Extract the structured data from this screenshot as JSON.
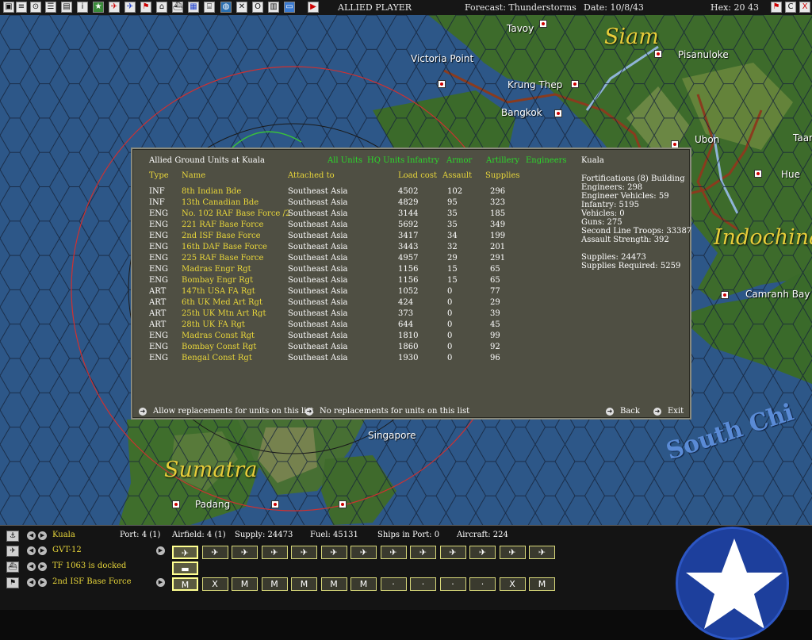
{
  "topbar": {
    "player": "ALLIED PLAYER",
    "forecast": "Forecast: Thunderstorms",
    "date": "Date: 10/8/43",
    "hex": "Hex: 20 43",
    "right_buttons": [
      "end-turn-icon",
      "C",
      "X"
    ]
  },
  "map": {
    "regions": [
      "Siam",
      "Indochina",
      "Sumatra"
    ],
    "sea": "South Chi",
    "cities": [
      "Tavoy",
      "Victoria Point",
      "Pisanuloke",
      "Krung Thep",
      "Bangkok",
      "Ubon",
      "Taar",
      "Hue",
      "Camranh Bay",
      "Singapore",
      "Padang"
    ],
    "colors": {
      "sea": "#2c5585",
      "land": "#3b6a2a",
      "border": "#8a3b1e",
      "range_circle": "#d03030"
    }
  },
  "panel": {
    "title": "Allied Ground Units at Kuala",
    "filters": [
      "All Units",
      "HQ Units",
      "Infantry",
      "Armor",
      "Artillery",
      "Engineers"
    ],
    "columns": [
      "Type",
      "Name",
      "Attached to",
      "Load cost",
      "Assault",
      "Supplies"
    ],
    "rows": [
      {
        "type": "INF",
        "name": "8th Indian Bde",
        "attached": "Southeast Asia",
        "load": "4502",
        "assault": "102",
        "supplies": "296"
      },
      {
        "type": "INF",
        "name": "13th Canadian Bde",
        "attached": "Southeast Asia",
        "load": "4829",
        "assault": "95",
        "supplies": "323"
      },
      {
        "type": "ENG",
        "name": "No. 102 RAF Base Force /2",
        "attached": "Southeast Asia",
        "load": "3144",
        "assault": "35",
        "supplies": "185"
      },
      {
        "type": "ENG",
        "name": "221 RAF Base Force",
        "attached": "Southeast Asia",
        "load": "5692",
        "assault": "35",
        "supplies": "349"
      },
      {
        "type": "ENG",
        "name": "2nd ISF Base Force",
        "attached": "Southeast Asia",
        "load": "3417",
        "assault": "34",
        "supplies": "199"
      },
      {
        "type": "ENG",
        "name": "16th DAF Base Force",
        "attached": "Southeast Asia",
        "load": "3443",
        "assault": "32",
        "supplies": "201"
      },
      {
        "type": "ENG",
        "name": "225 RAF Base Force",
        "attached": "Southeast Asia",
        "load": "4957",
        "assault": "29",
        "supplies": "291"
      },
      {
        "type": "ENG",
        "name": "Madras Engr Rgt",
        "attached": "Southeast Asia",
        "load": "1156",
        "assault": "15",
        "supplies": "65"
      },
      {
        "type": "ENG",
        "name": "Bombay Engr Rgt",
        "attached": "Southeast Asia",
        "load": "1156",
        "assault": "15",
        "supplies": "65"
      },
      {
        "type": "ART",
        "name": "147th USA FA Rgt",
        "attached": "Southeast Asia",
        "load": "1052",
        "assault": "0",
        "supplies": "77"
      },
      {
        "type": "ART",
        "name": "6th UK Med Art Rgt",
        "attached": "Southeast Asia",
        "load": "424",
        "assault": "0",
        "supplies": "29"
      },
      {
        "type": "ART",
        "name": "25th UK Mtn Art Rgt",
        "attached": "Southeast Asia",
        "load": "373",
        "assault": "0",
        "supplies": "39"
      },
      {
        "type": "ART",
        "name": "28th UK FA Rgt",
        "attached": "Southeast Asia",
        "load": "644",
        "assault": "0",
        "supplies": "45"
      },
      {
        "type": "ENG",
        "name": "Madras Const Rgt",
        "attached": "Southeast Asia",
        "load": "1810",
        "assault": "0",
        "supplies": "99"
      },
      {
        "type": "ENG",
        "name": "Bombay Const Rgt",
        "attached": "Southeast Asia",
        "load": "1860",
        "assault": "0",
        "supplies": "92"
      },
      {
        "type": "ENG",
        "name": "Bengal Const Rgt",
        "attached": "Southeast Asia",
        "load": "1930",
        "assault": "0",
        "supplies": "96"
      }
    ],
    "info": {
      "location": "Kuala",
      "fortifications": "Fortifications (8) Building",
      "engineers": "Engineers: 298",
      "engineer_vehicles": "Engineer Vehicles: 59",
      "infantry": "Infantry: 5195",
      "vehicles": "Vehicles: 0",
      "guns": "Guns: 275",
      "second_line": "Second Line Troops: 33387",
      "assault_strength": "Assault Strength: 392",
      "supplies": "Supplies: 24473",
      "supplies_required": "Supplies Required: 5259"
    },
    "buttons": {
      "allow": "Allow replacements for units on this list",
      "no": "No replacements for units on this list",
      "back": "Back",
      "exit": "Exit"
    }
  },
  "bottom": {
    "base": "Kuala",
    "port": "Port: 4 (1)",
    "airfield": "Airfield: 4 (1)",
    "supply": "Supply: 24473",
    "fuel": "Fuel: 45131",
    "ships": "Ships in Port: 0",
    "aircraft": "Aircraft: 224",
    "air_group": "GVT-12",
    "task_force": "TF 1063 is docked",
    "ground_unit": "2nd ISF Base Force",
    "air_slots": 13,
    "ground_slots": [
      "M",
      "X",
      "M",
      "M",
      "M",
      "M",
      "M",
      "·",
      "·",
      "·",
      "·",
      "X",
      "M"
    ]
  }
}
